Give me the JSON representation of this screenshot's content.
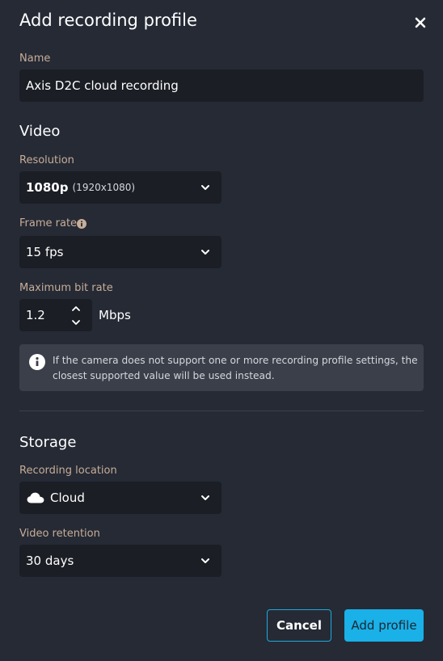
{
  "dialog": {
    "title": "Add recording profile",
    "close_icon": "close-icon"
  },
  "name": {
    "label": "Name",
    "value": "Axis D2C cloud recording"
  },
  "video": {
    "section_title": "Video",
    "resolution": {
      "label": "Resolution",
      "value": "1080p",
      "detail": "(1920x1080)"
    },
    "frame_rate": {
      "label": "Frame rate",
      "info_icon": "info-icon",
      "value": "15 fps"
    },
    "bit_rate": {
      "label": "Maximum bit rate",
      "value": "1.2",
      "unit": "Mbps"
    },
    "notice": "If the camera does not support one or more recording profile settings, the closest supported value will be used instead."
  },
  "storage": {
    "section_title": "Storage",
    "location": {
      "label": "Recording location",
      "value": "Cloud",
      "icon": "cloud-icon"
    },
    "retention": {
      "label": "Video retention",
      "value": "30 days"
    }
  },
  "actions": {
    "cancel_label": "Cancel",
    "add_label": "Add profile"
  },
  "colors": {
    "background": "#252a35",
    "field": "#1b1e25",
    "label": "#c8ad98",
    "accent": "#1ab0e8",
    "notice_bg": "#3a3f49"
  }
}
